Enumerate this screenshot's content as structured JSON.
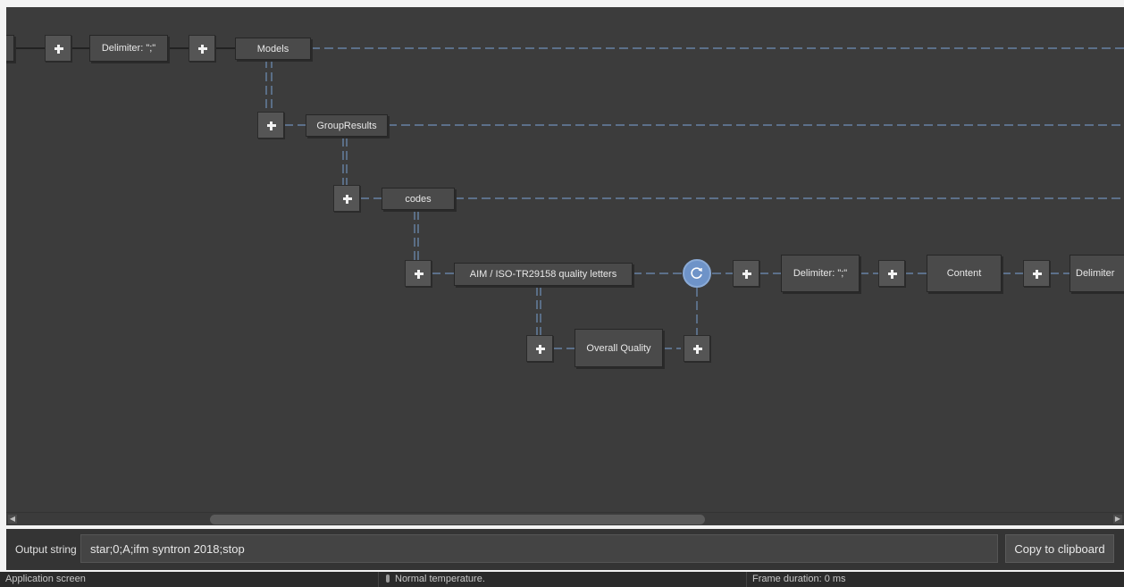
{
  "canvas": {
    "nodes": {
      "delimiter_top": "Delimiter: \";\"",
      "models": "Models",
      "group_results": "GroupResults",
      "codes": "codes",
      "aim_quality": "AIM / ISO-TR29158 quality letters",
      "overall_quality": "Overall Quality",
      "delimiter_mid": "Delimiter: \";\"",
      "content": "Content",
      "delimiter_right": "Delimiter"
    },
    "icons": {
      "add": "plus-icon",
      "loop": "loop-icon",
      "scroll_left": "arrow-left-icon",
      "scroll_right": "arrow-right-icon",
      "temperature": "thermometer-icon"
    },
    "colors": {
      "canvas_bg": "#3c3c3c",
      "wire": "#6f8fb8",
      "loop": "#6e93c8"
    }
  },
  "output": {
    "label": "Output string",
    "value": "star;0;A;ifm syntron 2018;stop",
    "copy_button": "Copy to clipboard"
  },
  "status": {
    "screen": "Application screen",
    "temperature": "Normal temperature.",
    "frame": "Frame duration: 0 ms"
  }
}
